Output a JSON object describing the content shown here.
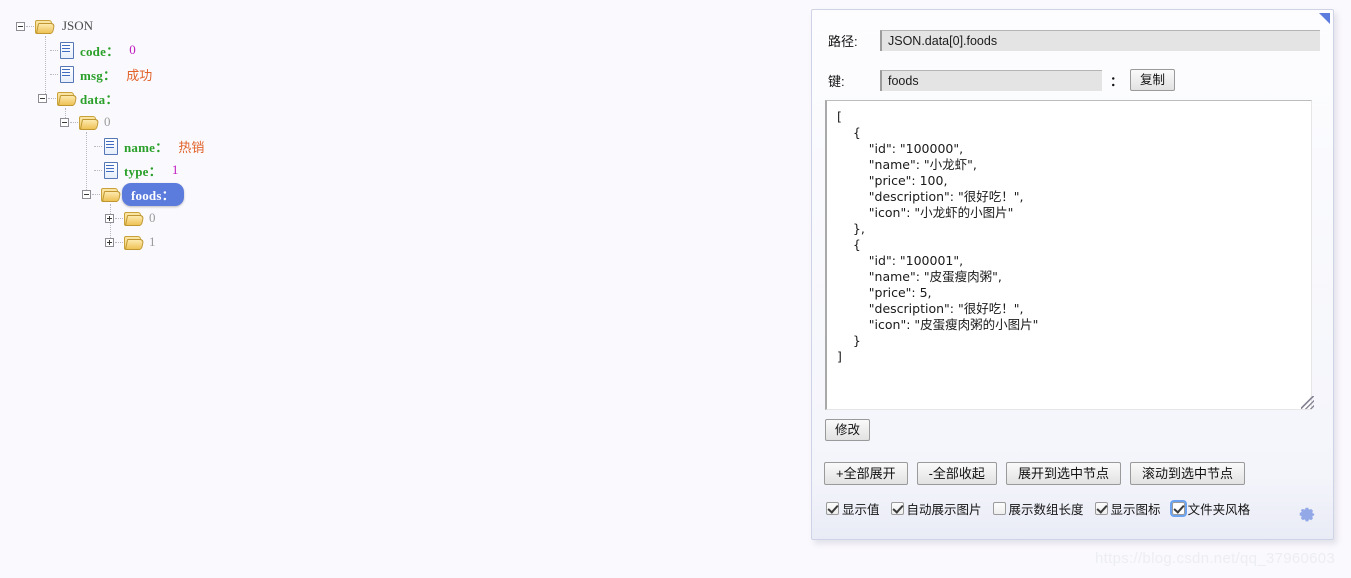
{
  "tree": {
    "nodes": [
      {
        "id": "root",
        "type": "folder",
        "toggle": "minus",
        "label": "JSON",
        "label_kind": "root",
        "value": "",
        "value_kind": "none",
        "depth": 0
      },
      {
        "id": "code",
        "type": "file",
        "toggle": "none",
        "label": "code：",
        "label_kind": "key",
        "value": "0",
        "value_kind": "number",
        "depth": 1
      },
      {
        "id": "msg",
        "type": "file",
        "toggle": "none",
        "label": "msg：",
        "label_kind": "key",
        "value": "成功",
        "value_kind": "string",
        "depth": 1
      },
      {
        "id": "data",
        "type": "folder",
        "toggle": "minus",
        "label": "data：",
        "label_kind": "key",
        "value": "",
        "value_kind": "none",
        "depth": 1
      },
      {
        "id": "data-0",
        "type": "folder",
        "toggle": "minus",
        "label": "0",
        "label_kind": "index",
        "value": "",
        "value_kind": "none",
        "depth": 2
      },
      {
        "id": "name",
        "type": "file",
        "toggle": "none",
        "label": "name：",
        "label_kind": "key",
        "value": "热销",
        "value_kind": "string",
        "depth": 3
      },
      {
        "id": "type",
        "type": "file",
        "toggle": "none",
        "label": "type：",
        "label_kind": "key",
        "value": "1",
        "value_kind": "number",
        "depth": 3
      },
      {
        "id": "foods",
        "type": "folder",
        "toggle": "minus",
        "label": "foods：",
        "label_kind": "key-selected",
        "value": "",
        "value_kind": "none",
        "depth": 3
      },
      {
        "id": "foods-0",
        "type": "folder",
        "toggle": "plus",
        "label": "0",
        "label_kind": "index",
        "value": "",
        "value_kind": "none",
        "depth": 4
      },
      {
        "id": "foods-1",
        "type": "folder",
        "toggle": "plus",
        "label": "1",
        "label_kind": "index",
        "value": "",
        "value_kind": "none",
        "depth": 4
      }
    ],
    "colors": {
      "key": "#2aa02a",
      "string_value": "#e2622a",
      "number_value": "#c018c0",
      "index": "#9b9b9b",
      "selection_bg": "#5b7bdd"
    }
  },
  "panel": {
    "path_field": {
      "label": "路径:",
      "value": "JSON.data[0].foods"
    },
    "key_field": {
      "label": "键:",
      "value": "foods",
      "separator": "：",
      "copy_button": "复制"
    },
    "editor": {
      "value": "[\n    {\n        \"id\": \"100000\",\n        \"name\": \"小龙虾\",\n        \"price\": 100,\n        \"description\": \"很好吃！\",\n        \"icon\": \"小龙虾的小图片\"\n    },\n    {\n        \"id\": \"100001\",\n        \"name\": \"皮蛋瘦肉粥\",\n        \"price\": 5,\n        \"description\": \"很好吃！\",\n        \"icon\": \"皮蛋瘦肉粥的小图片\"\n    }\n]"
    },
    "modify_button": "修改",
    "actions": [
      {
        "id": "expand-all",
        "label": "+全部展开"
      },
      {
        "id": "collapse-all",
        "label": "-全部收起"
      },
      {
        "id": "expand-to-node",
        "label": "展开到选中节点"
      },
      {
        "id": "scroll-to-node",
        "label": "滚动到选中节点"
      }
    ],
    "options": [
      {
        "id": "show-value",
        "label": "显示值",
        "checked": true,
        "focused": false
      },
      {
        "id": "auto-show-image",
        "label": "自动展示图片",
        "checked": true,
        "focused": false
      },
      {
        "id": "show-array-length",
        "label": "展示数组长度",
        "checked": false,
        "focused": false
      },
      {
        "id": "show-icon",
        "label": "显示图标",
        "checked": true,
        "focused": false
      },
      {
        "id": "folder-style",
        "label": "文件夹风格",
        "checked": true,
        "focused": true
      }
    ],
    "gear_icon": "gear-icon",
    "collapse_handle": "collapse-triangle-icon"
  },
  "watermark": "https://blog.csdn.net/qq_37960603"
}
